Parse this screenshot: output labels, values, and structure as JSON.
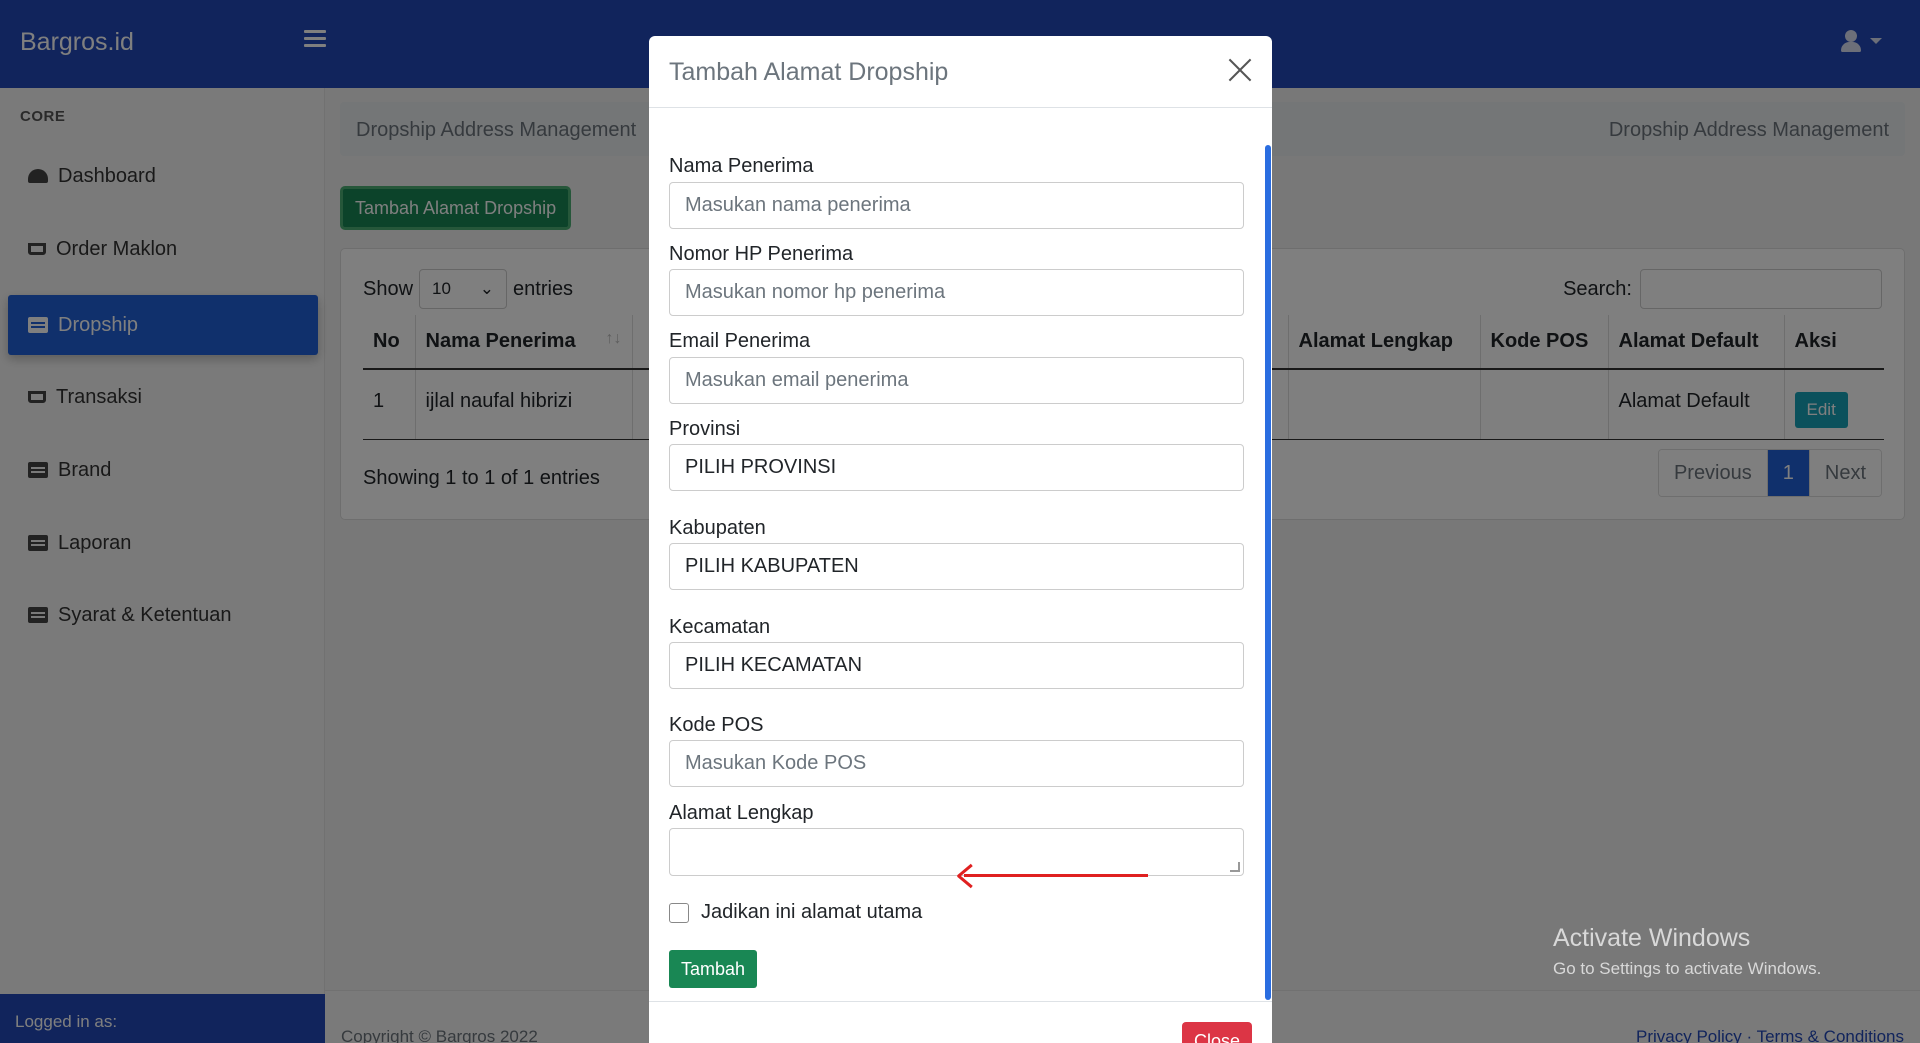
{
  "app": {
    "brand": "Bargros.id"
  },
  "sidebar": {
    "heading": "CORE",
    "items": [
      {
        "label": "Dashboard",
        "icon": "dashboard-icon"
      },
      {
        "label": "Order Maklon",
        "icon": "cart-icon"
      },
      {
        "label": "Dropship",
        "icon": "store-icon"
      },
      {
        "label": "Transaksi",
        "icon": "cart-icon"
      },
      {
        "label": "Brand",
        "icon": "store-icon"
      },
      {
        "label": "Laporan",
        "icon": "store-icon"
      },
      {
        "label": "Syarat & Ketentuan",
        "icon": "store-icon"
      }
    ],
    "active_index": 2,
    "footer": "Logged in as:"
  },
  "breadcrumb": {
    "left": "Dropship Address Management",
    "right": "Dropship Address Management"
  },
  "main": {
    "add_button": "Tambah Alamat Dropship",
    "show_label": "Show",
    "entries_label": "entries",
    "page_length": "10",
    "search_label": "Search:",
    "table": {
      "headers": [
        "No",
        "Nama Penerima",
        "Alamat Lengkap",
        "Kode POS",
        "Alamat Default",
        "Aksi"
      ],
      "rows": [
        {
          "no": "1",
          "nama": "ijlal naufal hibrizi",
          "alamat": "",
          "kode_pos": "",
          "default": "Alamat Default",
          "aksi": "Edit"
        }
      ]
    },
    "showing": "Showing 1 to 1 of 1 entries",
    "pagination": {
      "prev": "Previous",
      "current": "1",
      "next": "Next"
    }
  },
  "footer": {
    "copyright": "Copyright © Bargros 2022",
    "links": "Privacy Policy · Terms & Conditions"
  },
  "watermark": {
    "title": "Activate Windows",
    "subtitle": "Go to Settings to activate Windows."
  },
  "modal": {
    "title": "Tambah Alamat Dropship",
    "fields": {
      "nama": {
        "label": "Nama Penerima",
        "placeholder": "Masukan nama penerima"
      },
      "hp": {
        "label": "Nomor HP Penerima",
        "placeholder": "Masukan nomor hp penerima"
      },
      "email": {
        "label": "Email Penerima",
        "placeholder": "Masukan email penerima"
      },
      "provinsi": {
        "label": "Provinsi",
        "value": "PILIH PROVINSI"
      },
      "kabupaten": {
        "label": "Kabupaten",
        "value": "PILIH KABUPATEN"
      },
      "kecamatan": {
        "label": "Kecamatan",
        "value": "PILIH KECAMATAN"
      },
      "kode_pos": {
        "label": "Kode POS",
        "placeholder": "Masukan Kode POS"
      },
      "alamat": {
        "label": "Alamat Lengkap",
        "value": ""
      }
    },
    "checkbox_label": "Jadikan ini alamat utama",
    "checkbox_checked": false,
    "submit": "Tambah",
    "close": "Close"
  },
  "colors": {
    "navbar": "#2348b8",
    "active_nav": "#2060d8",
    "success": "#198754",
    "danger": "#dc3545",
    "info": "#17a2b8",
    "annotation_arrow": "#e02020"
  }
}
